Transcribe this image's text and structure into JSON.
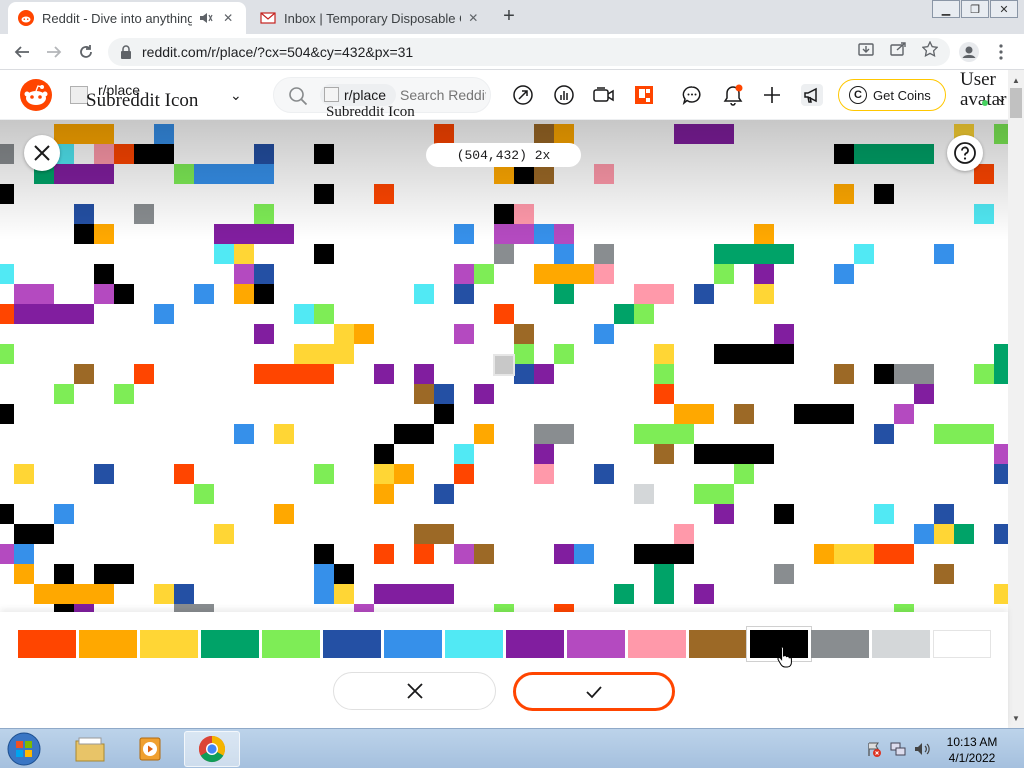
{
  "browser": {
    "tabs": [
      {
        "title": "Reddit - Dive into anything",
        "active": true
      },
      {
        "title": "Inbox | Temporary Disposable Gmail",
        "active": false
      }
    ],
    "url": "reddit.com/r/place/?cx=504&cy=432&px=31"
  },
  "reddit": {
    "community_image_alt": "Subreddit Icon",
    "community_label": "r/place",
    "search_chip": "r/place",
    "search_chip_alt": "Subreddit Icon",
    "search_placeholder": "Search Reddit",
    "get_coins": "Get Coins",
    "user_label": "User avatar"
  },
  "place": {
    "coordinates": "(504,432) 2x",
    "palette": [
      "#ff4500",
      "#ffa800",
      "#ffd635",
      "#00a368",
      "#7eed56",
      "#2450a4",
      "#3690ea",
      "#51e9f4",
      "#811e9f",
      "#b44ac0",
      "#ff99aa",
      "#9c6926",
      "#000000",
      "#898d90",
      "#d4d7d9",
      "#ffffff"
    ],
    "selected_index": 12
  },
  "taskbar": {
    "time": "10:13 AM",
    "date": "4/1/2022"
  }
}
